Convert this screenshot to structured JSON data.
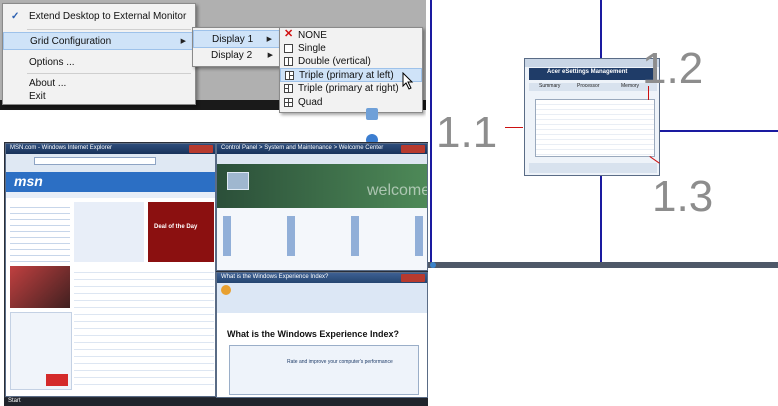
{
  "context_menu": {
    "items": [
      {
        "label": "Extend Desktop to External Monitor",
        "checked": true
      },
      {
        "label": "Grid Configuration",
        "has_submenu": true
      },
      {
        "label": "Options ..."
      },
      {
        "label": "About ..."
      },
      {
        "label": "Exit"
      }
    ]
  },
  "display_submenu": {
    "items": [
      {
        "label": "Display 1",
        "has_submenu": true
      },
      {
        "label": "Display 2",
        "has_submenu": true
      }
    ]
  },
  "grid_submenu": {
    "items": [
      {
        "label": "NONE",
        "icon": "red-x-icon"
      },
      {
        "label": "Single",
        "icon": "single-grid-icon"
      },
      {
        "label": "Double (vertical)",
        "icon": "double-vertical-grid-icon"
      },
      {
        "label": "Triple (primary at left)",
        "icon": "triple-left-grid-icon",
        "highlighted": true
      },
      {
        "label": "Triple (primary at right)",
        "icon": "triple-right-grid-icon"
      },
      {
        "label": "Quad",
        "icon": "quad-grid-icon"
      }
    ]
  },
  "callouts": {
    "one": "1.1",
    "two": "1.2",
    "three": "1.3"
  },
  "dialog": {
    "header": "Acer eSettings Management",
    "tabs": [
      "Summary",
      "Processor",
      "Memory"
    ]
  },
  "taskbar": {
    "start": "Start"
  },
  "ie_window": {
    "title": "MSN.com - Windows Internet Explorer",
    "logo": "msn",
    "headline": "Deal of the Day"
  },
  "cp_window": {
    "title": "Control Panel > System and Maintenance > Welcome Center",
    "welcome": "welcome"
  },
  "word_window": {
    "title": "What is the Windows Experience Index?",
    "heading": "What is the Windows Experience Index?",
    "sub": "Rate and improve your computer's performance"
  },
  "colors": {
    "accent_line": "#1a1aa0",
    "menu_bg": "#f2f2f2",
    "highlight": "#cfe3f8",
    "title_bar": "#1f3c68"
  }
}
